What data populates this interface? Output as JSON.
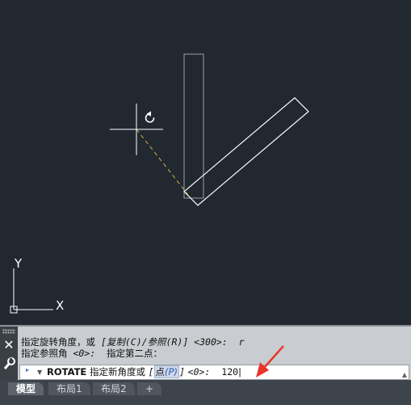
{
  "command_line": {
    "history": [
      {
        "prefix": "指定旋转角度，或 ",
        "option": "[复制(C)/参照(R)] <300>:",
        "input": "r"
      },
      {
        "prefix": "指定参照角 ",
        "option": "<0>:",
        "suffix": "  指定第二点："
      }
    ],
    "prompt": {
      "command": "ROTATE",
      "text": "指定新角度或",
      "option_open": "[",
      "option_label": "点",
      "option_key_open": "(",
      "option_key": "P",
      "option_key_close": ")",
      "option_close": "]",
      "default": "<0>:",
      "typed_value": "120"
    }
  },
  "ucs": {
    "y_label": "Y",
    "x_label": "X"
  },
  "tabs": [
    {
      "label": "模型",
      "active": true
    },
    {
      "label": "布局1",
      "active": false
    },
    {
      "label": "布局2",
      "active": false
    },
    {
      "label": "+",
      "active": false
    }
  ],
  "icons": {
    "close": "close-icon",
    "customize": "wrench-icon",
    "rotate_cursor": "rotate-icon",
    "prompt": "prompt-arrow-icon"
  },
  "colors": {
    "canvas_bg": "#212830",
    "geometry": "#ffffff",
    "original_geometry": "#9aa0a6",
    "rubber_band": "#d8b03a",
    "annotation_arrow": "#e8372c"
  }
}
